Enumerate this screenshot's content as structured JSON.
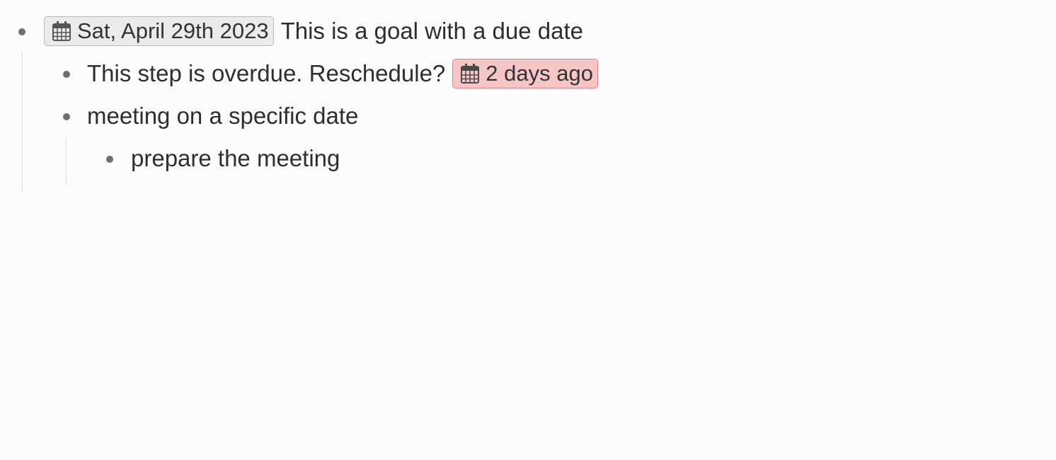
{
  "outline": {
    "item1": {
      "date_tag": {
        "label": "Sat, April 29th 2023",
        "icon": "calendar-icon"
      },
      "text": "This is a goal with a due date"
    },
    "item1_1": {
      "text": "This step is overdue. Reschedule?",
      "date_tag": {
        "label": "2 days ago",
        "icon": "calendar-icon",
        "status": "overdue"
      }
    },
    "item1_2": {
      "text": "meeting on a specific date"
    },
    "item1_2_1": {
      "text": "prepare the meeting"
    }
  },
  "colors": {
    "background": "#fcfcfc",
    "text": "#2e2e2e",
    "bullet": "#6e6e6e",
    "neutral_tag_bg": "#ebebeb",
    "neutral_tag_border": "#b9b9b9",
    "overdue_tag_bg": "#f6c6c6",
    "overdue_tag_border": "#e07f7f"
  }
}
